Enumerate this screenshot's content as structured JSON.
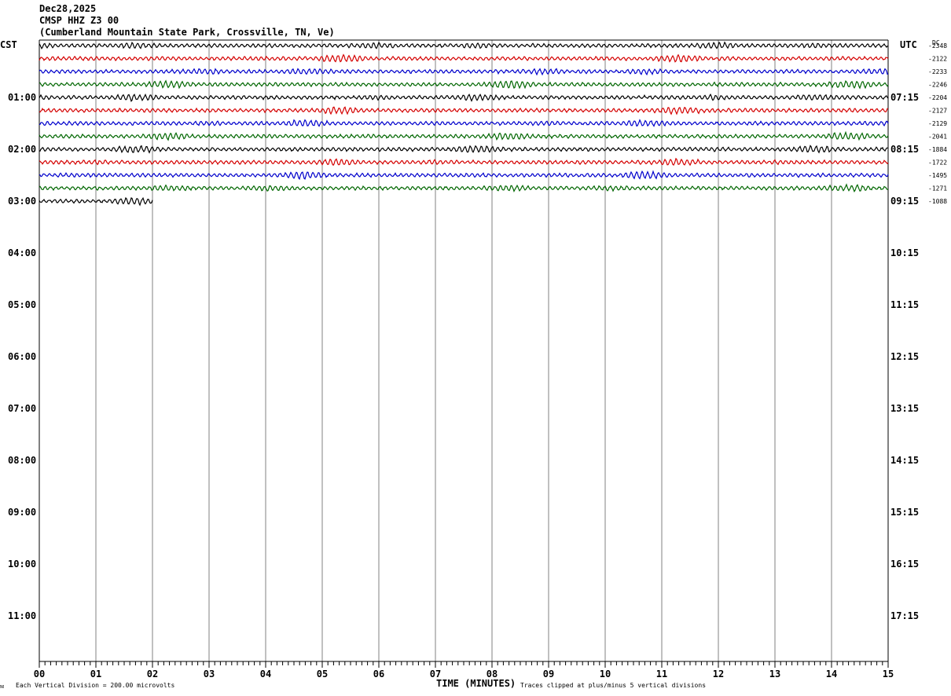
{
  "header": {
    "date": "Dec28,2025",
    "station": "CMSP HHZ Z3 00",
    "location": "(Cumberland Mountain State Park, Crossville, TN, Ve)"
  },
  "left_tz": "CST",
  "right_tz": "UTC",
  "dc_label": "DC",
  "x_axis_title": "TIME (MINUTES)",
  "footer": {
    "scale_note": "Each Vertical Division =  200.00 microvolts",
    "clip_note": "Traces clipped at plus/minus 5 vertical divisions"
  },
  "chart_data": {
    "type": "line",
    "title": "CMSP HHZ Z3 00",
    "x_range_minutes": [
      0,
      15
    ],
    "x_ticks": [
      "00",
      "01",
      "02",
      "03",
      "04",
      "05",
      "06",
      "07",
      "08",
      "09",
      "10",
      "11",
      "12",
      "13",
      "14",
      "15"
    ],
    "left_hour_labels": [
      "",
      "01:00",
      "02:00",
      "03:00",
      "04:00",
      "05:00",
      "06:00",
      "07:00",
      "08:00",
      "09:00",
      "10:00",
      "11:00"
    ],
    "right_hour_labels": [
      "",
      "07:15",
      "08:15",
      "09:15",
      "10:15",
      "11:15",
      "12:15",
      "13:15",
      "14:15",
      "15:15",
      "16:15",
      "17:15"
    ],
    "trace_colors": [
      "#000000",
      "#d40000",
      "#0000cc",
      "#006600"
    ],
    "dc_offsets": [
      "-2348",
      "-2122",
      "-2233",
      "-2246",
      "-2204",
      "-2127",
      "-2129",
      "-2041",
      "-1884",
      "-1722",
      "-1495",
      "-1271",
      "-1088"
    ],
    "trace_lengths_minutes": [
      15,
      15,
      15,
      15,
      15,
      15,
      15,
      15,
      15,
      15,
      15,
      15,
      2
    ],
    "grid": "vertical-minute-lines"
  }
}
